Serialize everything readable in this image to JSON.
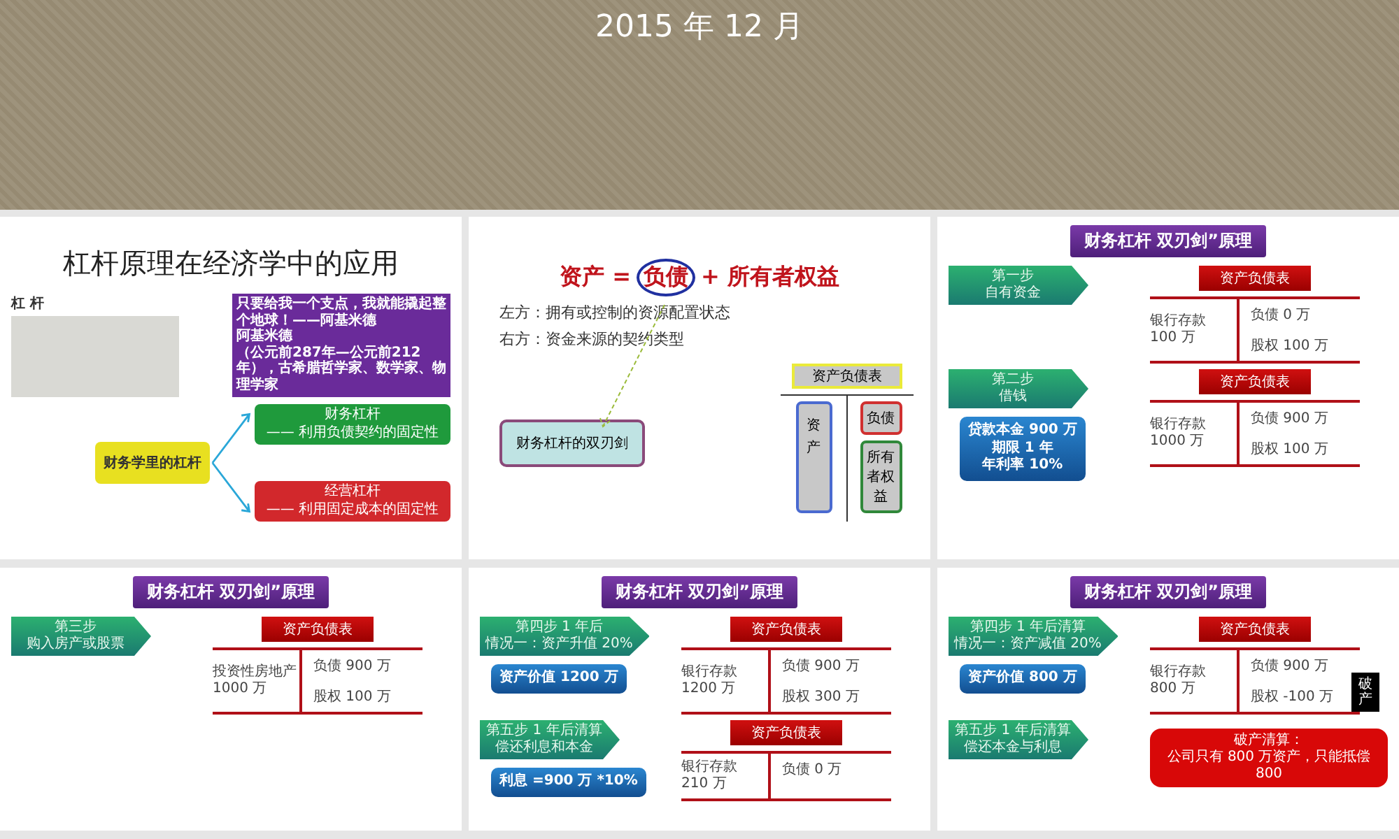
{
  "cover": {
    "date": "2015 年 12 月"
  },
  "slides": [
    {
      "kind": "leverage",
      "title": "杠杆原理在经济学中的应用",
      "caption": "杠 杆",
      "quote": [
        "只要给我一个支点，我就能撬起整个地球！——阿基米德",
        "阿基米德",
        "（公元前287年—公元前212年），古希腊哲学家、数学家、物理学家"
      ],
      "center": "财务学里的杠杆",
      "branches": [
        {
          "lines": [
            "财务杠杆",
            "—— 利用负债契约的固定性"
          ],
          "color": "#1f9a3c"
        },
        {
          "lines": [
            "经营杠杆",
            "—— 利用固定成本的固定性"
          ],
          "color": "#d2282c"
        }
      ]
    },
    {
      "kind": "equation",
      "equation": {
        "left": "资产 =",
        "circled": "负债",
        "right": "+ 所有者权益"
      },
      "lines": [
        "左方：拥有或控制的资源配置状态",
        "右方：资金来源的契约类型"
      ],
      "box": "财务杠杆的双刃剑",
      "table": {
        "header": "资产负债表",
        "left": "资产",
        "right": [
          "负债",
          "所有者权益"
        ]
      }
    },
    {
      "kind": "steps",
      "title": "财务杠杆 双刃剑”原理",
      "rows": [
        {
          "step": [
            "第一步",
            "自有资金"
          ],
          "sheet": {
            "header": "资产负债表",
            "left": "银行存款 100 万",
            "right": [
              "负债 0 万",
              "股权 100 万"
            ]
          }
        },
        {
          "step": [
            "第二步",
            "借钱"
          ],
          "note": [
            "贷款本金 900 万",
            "期限 1 年",
            "年利率 10%"
          ],
          "sheet": {
            "header": "资产负债表",
            "left": "银行存款 1000 万",
            "right": [
              "负债 900 万",
              "股权 100 万"
            ]
          }
        }
      ]
    },
    {
      "kind": "steps",
      "title": "财务杠杆 双刃剑”原理",
      "rows": [
        {
          "step": [
            "第三步",
            "购入房产或股票"
          ],
          "sheet": {
            "header": "资产负债表",
            "left": "投资性房地产 1000 万",
            "right": [
              "负债 900 万",
              "股权 100 万"
            ]
          }
        }
      ]
    },
    {
      "kind": "steps",
      "title": "财务杠杆 双刃剑”原理",
      "rows": [
        {
          "step": [
            "第四步 1 年后",
            "情况一：资产升值 20%"
          ],
          "note": [
            "资产价值 1200 万"
          ],
          "sheet": {
            "header": "资产负债表",
            "left": "银行存款 1200 万",
            "right": [
              "负债 900 万",
              "股权 300 万"
            ]
          }
        },
        {
          "step": [
            "第五步 1 年后清算",
            "偿还利息和本金"
          ],
          "note": [
            "利息 =900 万 *10%"
          ],
          "sheet": {
            "header": "资产负债表",
            "left": "银行存款 210 万",
            "right": [
              "负债 0 万"
            ]
          }
        }
      ]
    },
    {
      "kind": "steps",
      "title": "财务杠杆 双刃剑”原理",
      "rows": [
        {
          "step": [
            "第四步 1 年后清算",
            "情况一：资产减值 20%"
          ],
          "note": [
            "资产价值 800 万"
          ],
          "sheet": {
            "header": "资产负债表",
            "left": "银行存款 800 万",
            "right": [
              "负债 900 万",
              "股权 -100 万"
            ],
            "stamp": "破产"
          }
        },
        {
          "step": [
            "第五步 1 年后清算",
            "偿还本金与利息"
          ],
          "alert": [
            "破产清算：",
            "公司只有 800 万资产，只能抵偿 800"
          ]
        }
      ]
    }
  ]
}
